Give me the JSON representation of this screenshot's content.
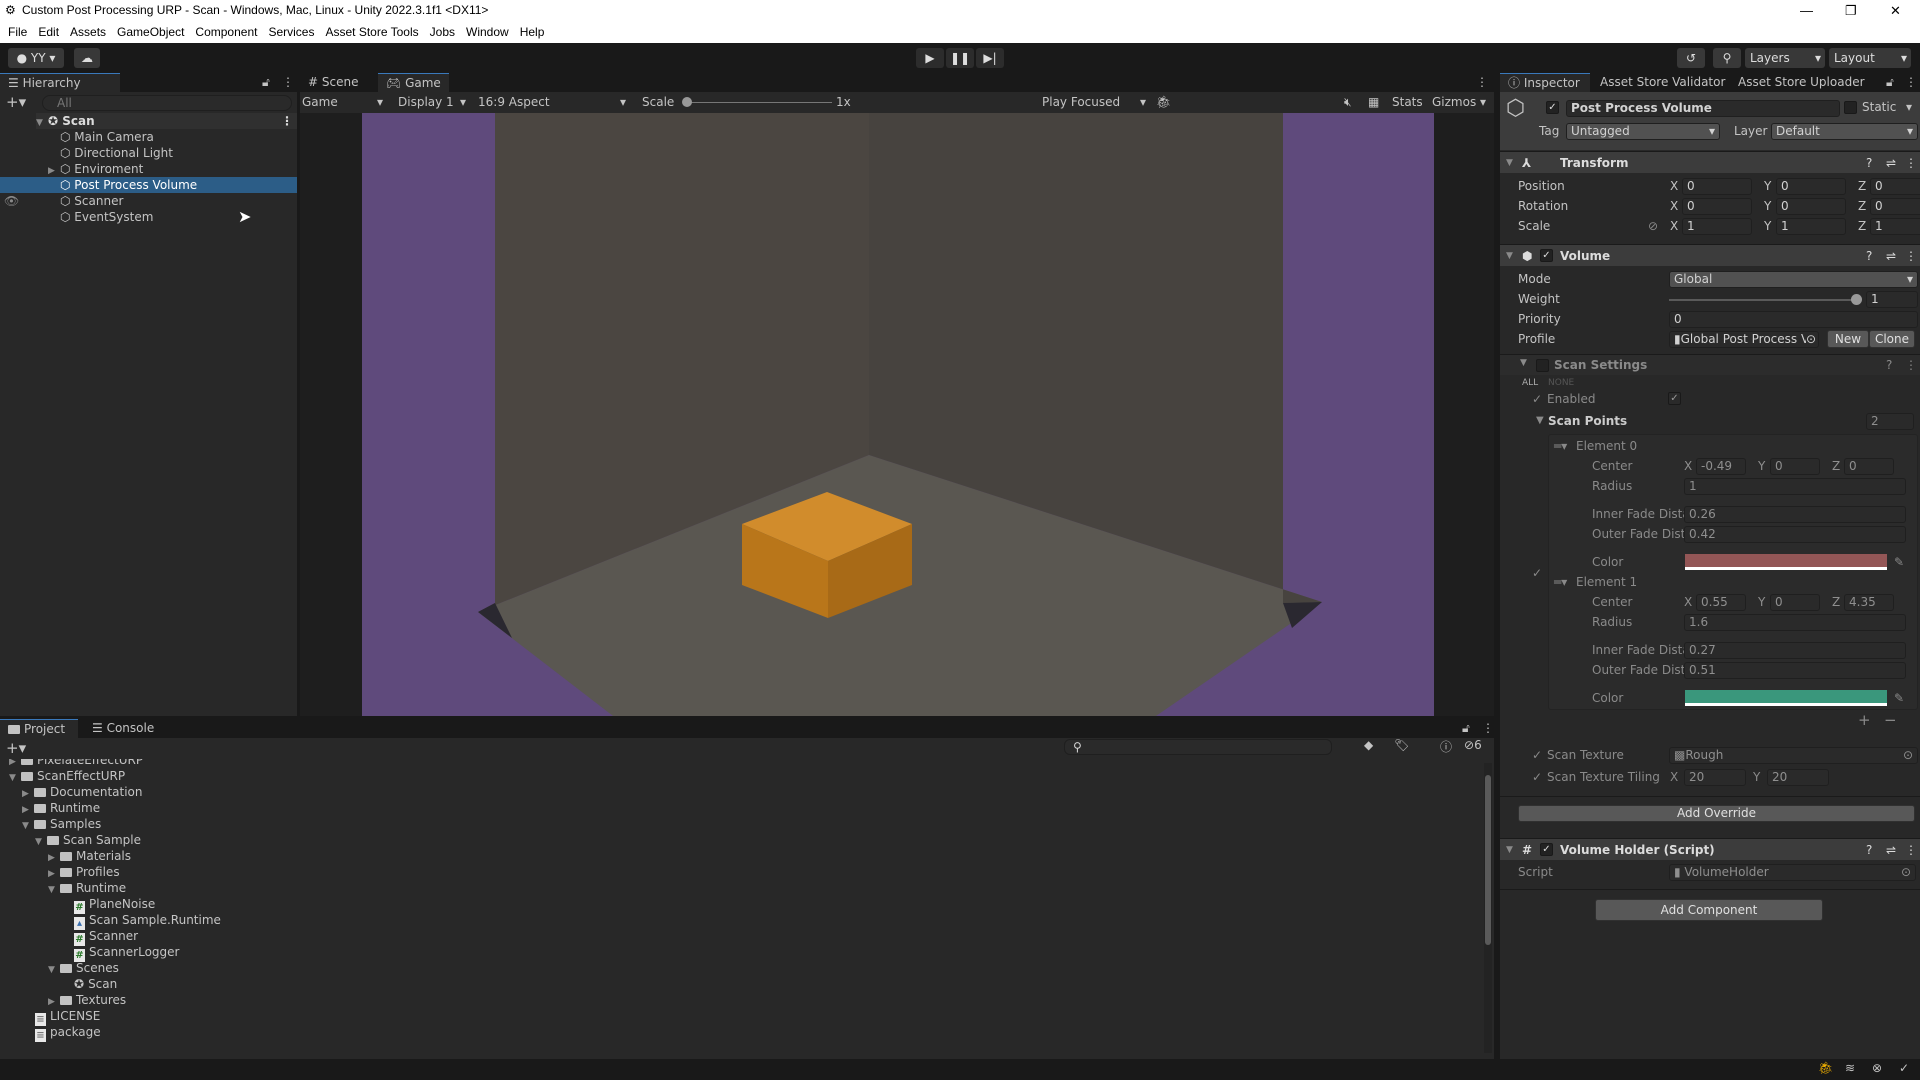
{
  "window": {
    "title": "Custom Post Processing URP - Scan - Windows, Mac, Linux - Unity 2022.3.1f1 <DX11>",
    "minimize": "—",
    "maximize": "❐",
    "close": "✕"
  },
  "menu": [
    "File",
    "Edit",
    "Assets",
    "GameObject",
    "Component",
    "Services",
    "Asset Store Tools",
    "Jobs",
    "Window",
    "Help"
  ],
  "toolbar": {
    "account": "YY",
    "layers": "Layers",
    "layout": "Layout"
  },
  "hierarchy": {
    "tab": "Hierarchy",
    "search_placeholder": "All",
    "root": "Scan",
    "items": [
      "Main Camera",
      "Directional Light",
      "Enviroment",
      "Post Process Volume",
      "Scanner",
      "EventSystem"
    ],
    "selected": "Post Process Volume"
  },
  "game": {
    "tabs": [
      "Scene",
      "Game"
    ],
    "active_tab": "Game",
    "mode": "Game",
    "display": "Display 1",
    "aspect": "16:9 Aspect",
    "scale_label": "Scale",
    "scale_value": "1x",
    "play_mode": "Play Focused",
    "stats": "Stats",
    "gizmos": "Gizmos",
    "colors": {
      "background": "#5f4a7c",
      "wall_left": "#4b4641",
      "wall_right": "#47433f",
      "floor": "#5a5751",
      "cube_top": "#d18c2c",
      "cube_left": "#b9761a",
      "cube_right": "#a86a17"
    }
  },
  "project": {
    "tabs": [
      "Project",
      "Console"
    ],
    "hidden_count": "6",
    "items": [
      {
        "label": "PixelateEffectURP",
        "type": "folder",
        "depth": 1,
        "open": false
      },
      {
        "label": "ScanEffectURP",
        "type": "folder",
        "depth": 1,
        "open": true
      },
      {
        "label": "Documentation",
        "type": "folder",
        "depth": 2,
        "open": false
      },
      {
        "label": "Runtime",
        "type": "folder",
        "depth": 2,
        "open": false
      },
      {
        "label": "Samples",
        "type": "folder",
        "depth": 2,
        "open": true
      },
      {
        "label": "Scan Sample",
        "type": "folder",
        "depth": 3,
        "open": true
      },
      {
        "label": "Materials",
        "type": "folder",
        "depth": 4,
        "open": false
      },
      {
        "label": "Profiles",
        "type": "folder",
        "depth": 4,
        "open": false
      },
      {
        "label": "Runtime",
        "type": "folder",
        "depth": 4,
        "open": true
      },
      {
        "label": "PlaneNoise",
        "type": "script",
        "depth": 5
      },
      {
        "label": "Scan Sample.Runtime",
        "type": "asmdef",
        "depth": 5
      },
      {
        "label": "Scanner",
        "type": "script",
        "depth": 5
      },
      {
        "label": "ScannerLogger",
        "type": "script",
        "depth": 5
      },
      {
        "label": "Scenes",
        "type": "folder",
        "depth": 4,
        "open": true
      },
      {
        "label": "Scan",
        "type": "scene",
        "depth": 5
      },
      {
        "label": "Textures",
        "type": "folder",
        "depth": 4,
        "open": false
      },
      {
        "label": "LICENSE",
        "type": "file",
        "depth": 2
      },
      {
        "label": "package",
        "type": "file",
        "depth": 2
      }
    ]
  },
  "inspector": {
    "tabs": [
      "Inspector",
      "Asset Store Validator",
      "Asset Store Uploader"
    ],
    "object_name": "Post Process Volume",
    "static_label": "Static",
    "tag_label": "Tag",
    "tag": "Untagged",
    "layer_label": "Layer",
    "layer": "Default",
    "transform": {
      "title": "Transform",
      "position_label": "Position",
      "rotation_label": "Rotation",
      "scale_label": "Scale",
      "position": [
        "0",
        "0",
        "0"
      ],
      "rotation": [
        "0",
        "0",
        "0"
      ],
      "scale": [
        "1",
        "1",
        "1"
      ]
    },
    "axes": [
      "X",
      "Y",
      "Z"
    ],
    "volume": {
      "title": "Volume",
      "mode_label": "Mode",
      "mode": "Global",
      "weight_label": "Weight",
      "weight": "1",
      "priority_label": "Priority",
      "priority": "0",
      "profile_label": "Profile",
      "profile": "Global Post Process V",
      "new": "New",
      "clone": "Clone"
    },
    "scan_settings": {
      "title": "Scan Settings",
      "all": "ALL",
      "none": "NONE",
      "enabled_label": "Enabled",
      "scan_points_label": "Scan Points",
      "scan_points_count": "2",
      "elements": [
        {
          "label": "Element 0",
          "center_label": "Center",
          "center": [
            "-0.49",
            "0",
            "0"
          ],
          "radius_label": "Radius",
          "radius": "1",
          "inner_label": "Inner Fade Dista",
          "inner": "0.26",
          "outer_label": "Outer Fade Dista",
          "outer": "0.42",
          "color_label": "Color",
          "color": "#935656"
        },
        {
          "label": "Element 1",
          "center_label": "Center",
          "center": [
            "0.55",
            "0",
            "4.35"
          ],
          "radius_label": "Radius",
          "radius": "1.6",
          "inner_label": "Inner Fade Dista",
          "inner": "0.27",
          "outer_label": "Outer Fade Dista",
          "outer": "0.51",
          "color_label": "Color",
          "color": "#3a977c"
        }
      ],
      "texture_label": "Scan Texture",
      "texture": "Rough",
      "tiling_label": "Scan Texture Tiling",
      "tiling": [
        "20",
        "20"
      ],
      "tiling_axes": [
        "X",
        "Y"
      ]
    },
    "add_override": "Add Override",
    "volume_holder": {
      "title": "Volume Holder (Script)",
      "script_label": "Script",
      "script": "VolumeHolder"
    },
    "add_component": "Add Component"
  }
}
